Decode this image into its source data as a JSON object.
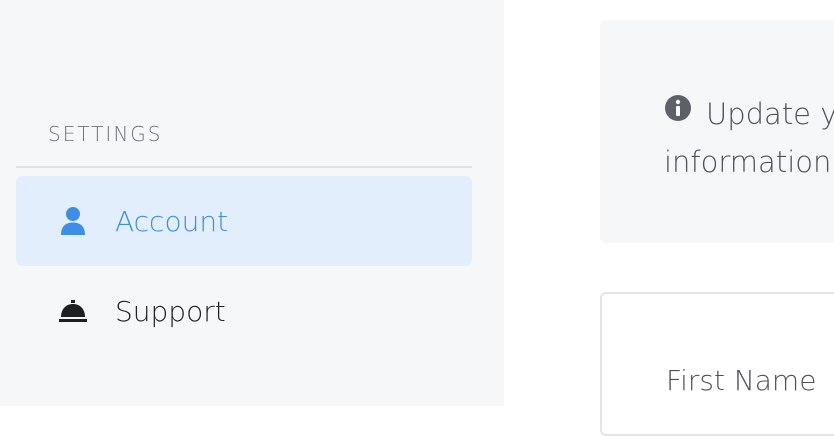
{
  "sidebar": {
    "section_heading": "SETTINGS",
    "items": [
      {
        "label": "Account",
        "icon": "user-icon",
        "active": true
      },
      {
        "label": "Support",
        "icon": "service-bell-icon",
        "active": false
      }
    ]
  },
  "main": {
    "info_text_line1": "Update y",
    "info_text_line2": "information.",
    "info_icon": "info-circle-icon",
    "form": {
      "first_name_label": "First Name"
    }
  },
  "colors": {
    "accent": "#3d8fe6",
    "active_bg": "#e2eefb",
    "sidebar_bg": "#f6f7f9"
  }
}
